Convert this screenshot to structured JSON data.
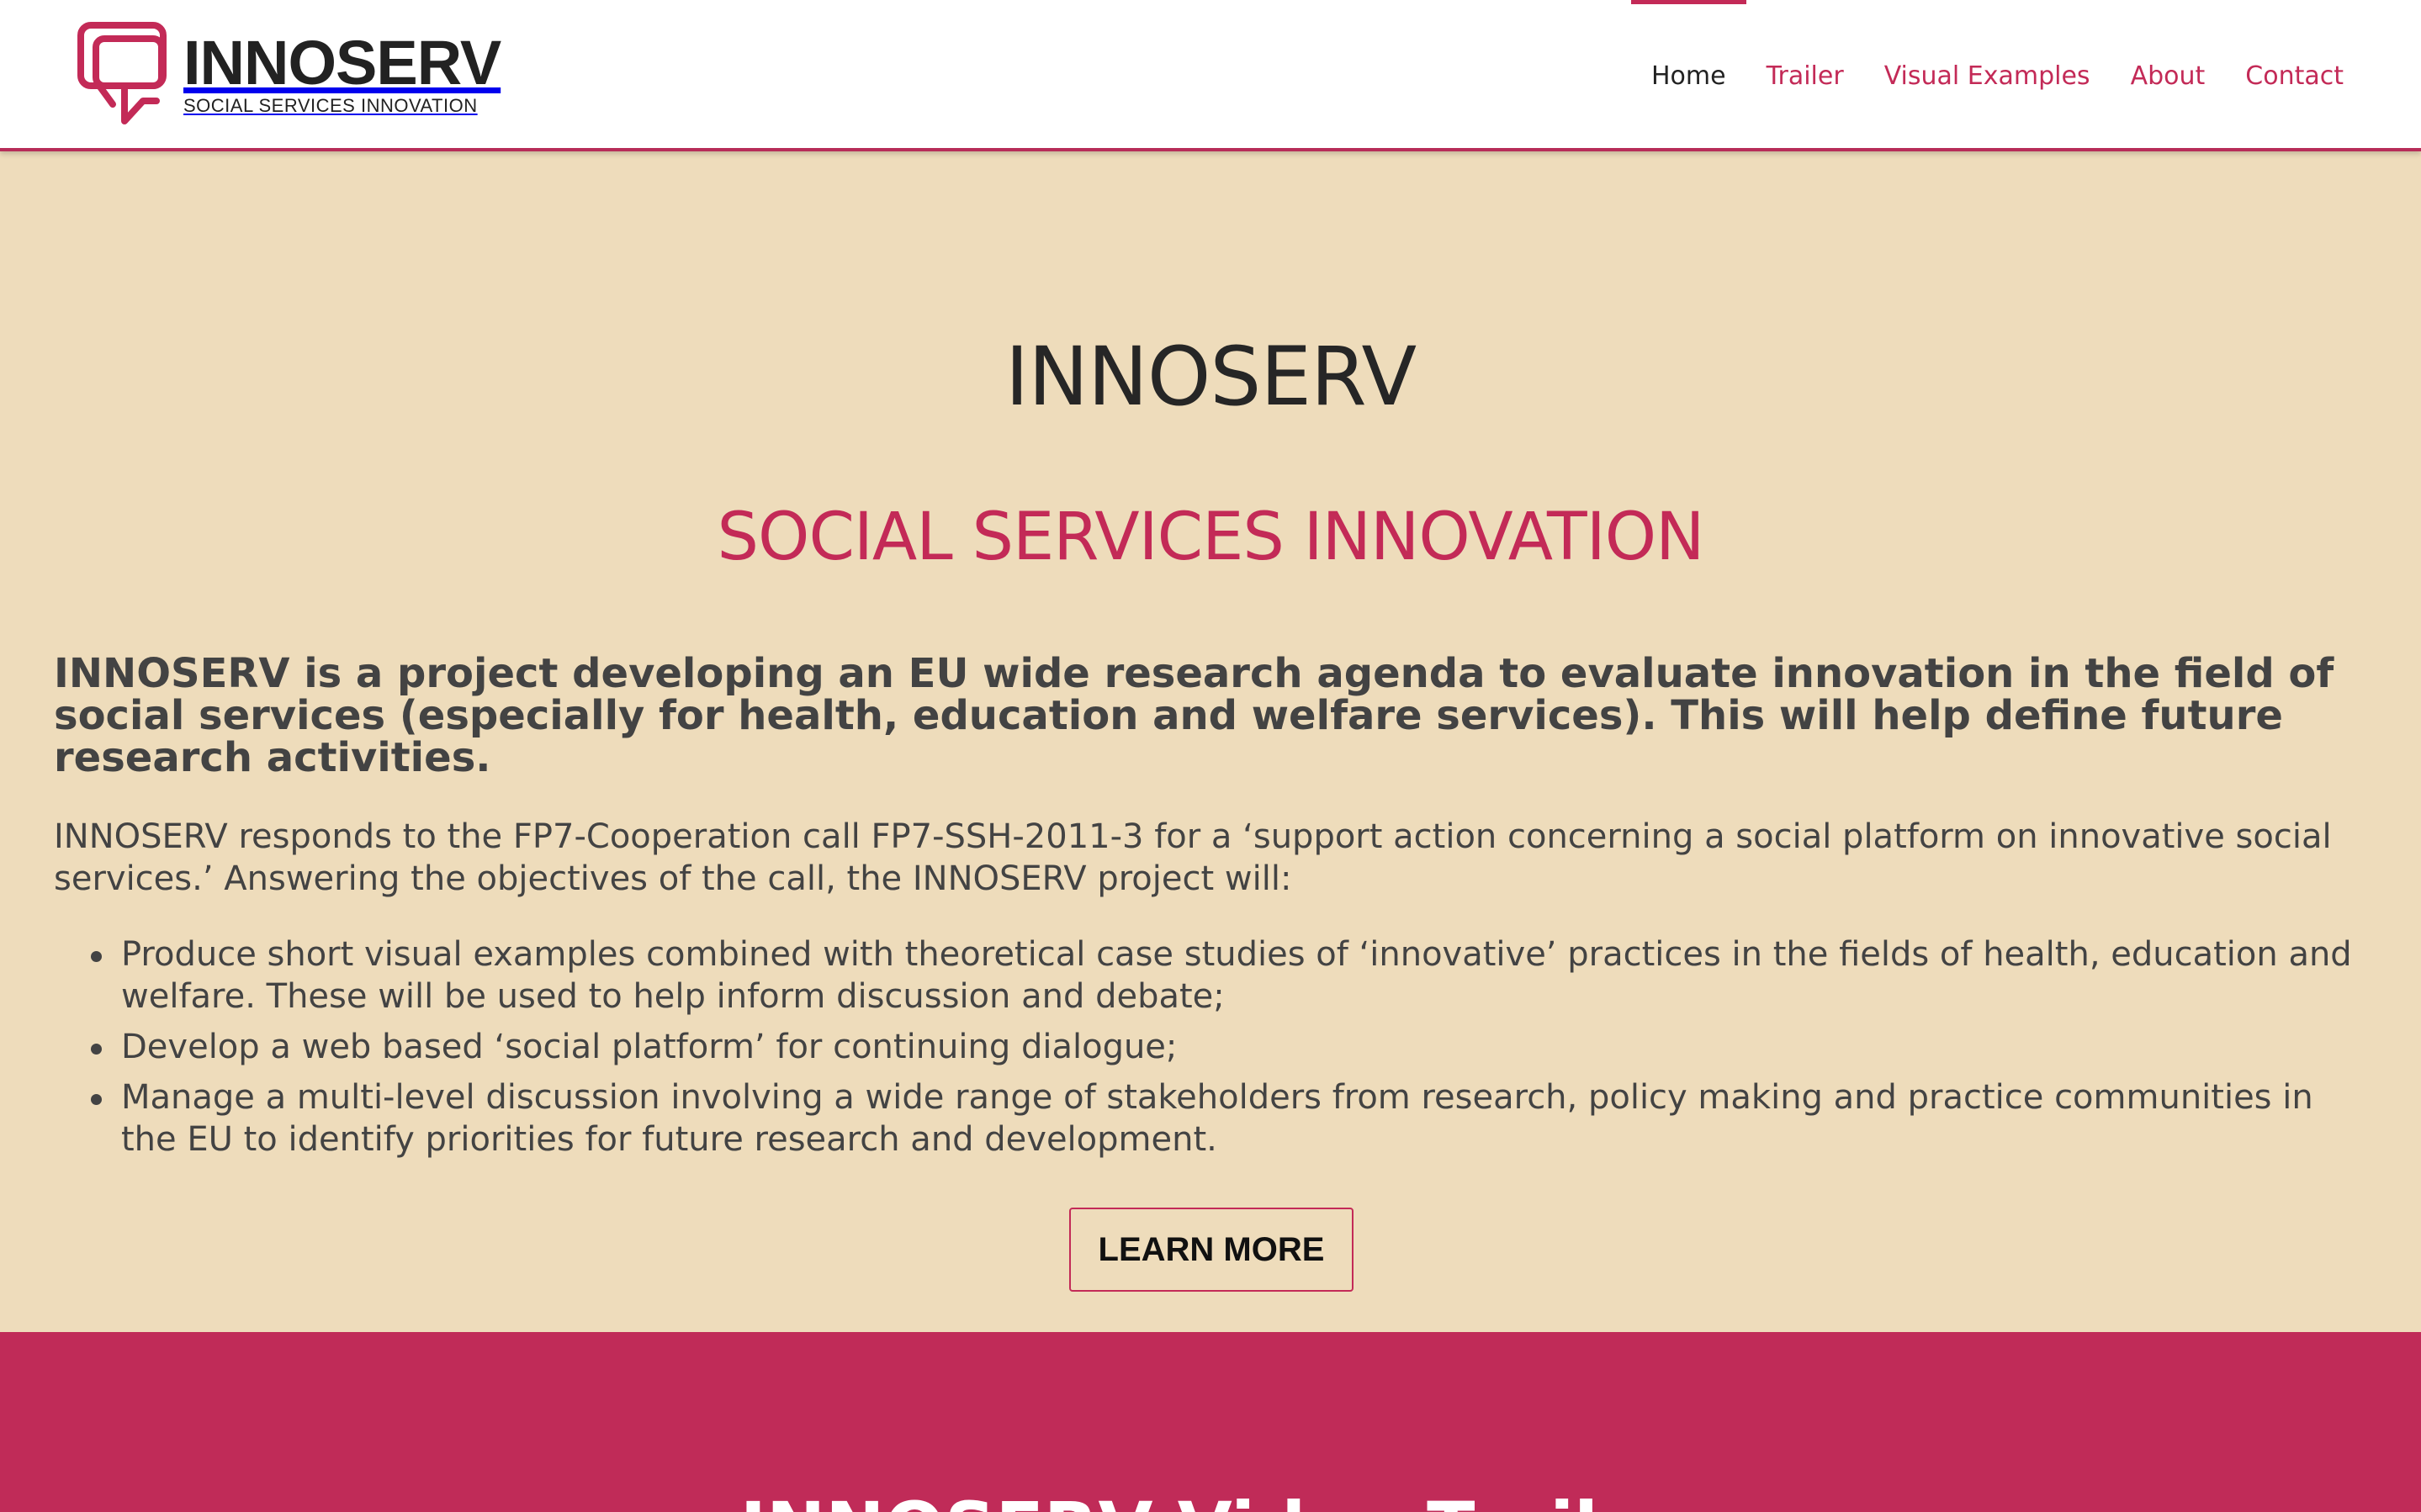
{
  "colors": {
    "accent": "#c32a57",
    "page_background": "#eedcbb",
    "header_background": "#ffffff",
    "text": "#434343",
    "section2_background": "#c02b58"
  },
  "header": {
    "logo": {
      "icon": "speech-bubbles-icon",
      "name": "INNOSERV",
      "tagline": "SOCIAL SERVICES INNOVATION"
    },
    "nav": [
      {
        "label": "Home",
        "active": true
      },
      {
        "label": "Trailer",
        "active": false
      },
      {
        "label": "Visual Examples",
        "active": false
      },
      {
        "label": "About",
        "active": false
      },
      {
        "label": "Contact",
        "active": false
      }
    ]
  },
  "hero": {
    "title": "INNOSERV",
    "subtitle": "SOCIAL SERVICES INNOVATION",
    "lead": "INNOSERV is a project developing an EU wide research agenda to evaluate innovation in the field of social services (especially for health, education and welfare services). This will help define future research activities.",
    "paragraph": "INNOSERV responds to the FP7-Cooperation call FP7-SSH-2011-3 for a ‘support action concerning a social platform on innovative social services.’ Answering the objectives of the call, the INNOSERV project will:",
    "bullets": [
      "Produce short visual examples combined with theoretical case studies of ‘innovative’ practices in the fields of health, education and welfare. These will be used to help inform discussion and debate;",
      "Develop a web based ‘social platform’ for continuing dialogue;",
      "Manage a multi-level discussion involving a wide range of stakeholders from research, policy making and practice communities in the EU to identify priorities for future research and development."
    ],
    "button_label": "LEARN MORE"
  },
  "section2": {
    "title": "INNOSERV Video Trailer"
  }
}
